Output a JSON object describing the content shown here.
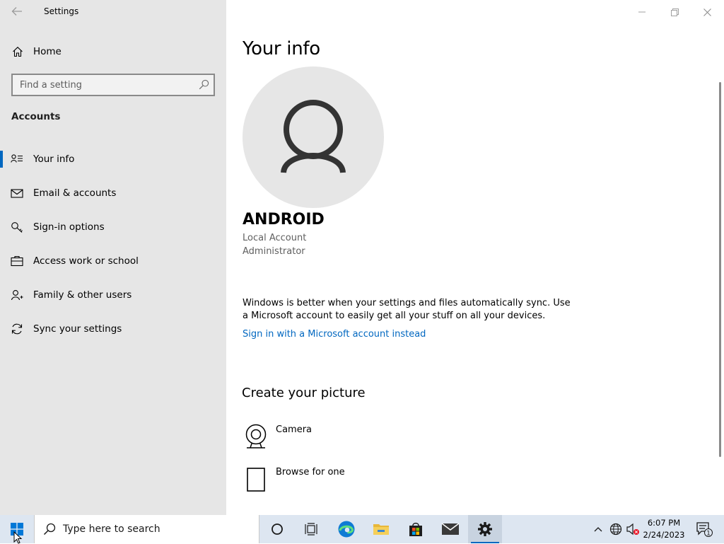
{
  "window": {
    "title": "Settings",
    "controls": [
      "minimize",
      "restore",
      "close"
    ]
  },
  "sidebar": {
    "home_label": "Home",
    "search_placeholder": "Find a setting",
    "section_heading": "Accounts",
    "items": [
      {
        "label": "Your info",
        "icon": "contact-card-icon",
        "selected": true
      },
      {
        "label": "Email & accounts",
        "icon": "mail-icon",
        "selected": false
      },
      {
        "label": "Sign-in options",
        "icon": "key-icon",
        "selected": false
      },
      {
        "label": "Access work or school",
        "icon": "briefcase-icon",
        "selected": false
      },
      {
        "label": "Family & other users",
        "icon": "add-person-icon",
        "selected": false
      },
      {
        "label": "Sync your settings",
        "icon": "sync-icon",
        "selected": false
      }
    ]
  },
  "main": {
    "title": "Your info",
    "user_name": "ANDROID",
    "account_type": "Local Account",
    "account_role": "Administrator",
    "sync_message": "Windows is better when your settings and files automatically sync. Use a Microsoft account to easily get all your stuff on all your devices.",
    "signin_link": "Sign in with a Microsoft account instead",
    "create_picture_title": "Create your picture",
    "picture_options": [
      {
        "label": "Camera",
        "icon": "camera-icon"
      },
      {
        "label": "Browse for one",
        "icon": "browse-icon"
      }
    ]
  },
  "taskbar": {
    "search_placeholder": "Type here to search",
    "apps": [
      "cortana-icon",
      "task-view-icon",
      "edge-icon",
      "file-explorer-icon",
      "store-icon",
      "mail-icon",
      "settings-icon"
    ],
    "active_app": "settings-icon",
    "tray": {
      "time": "6:07 PM",
      "date": "2/24/2023",
      "notification_count": "1"
    }
  },
  "colors": {
    "accent": "#0067c0",
    "sidebar_bg": "#e6e6e6",
    "taskbar_bg": "#dde6f1"
  }
}
